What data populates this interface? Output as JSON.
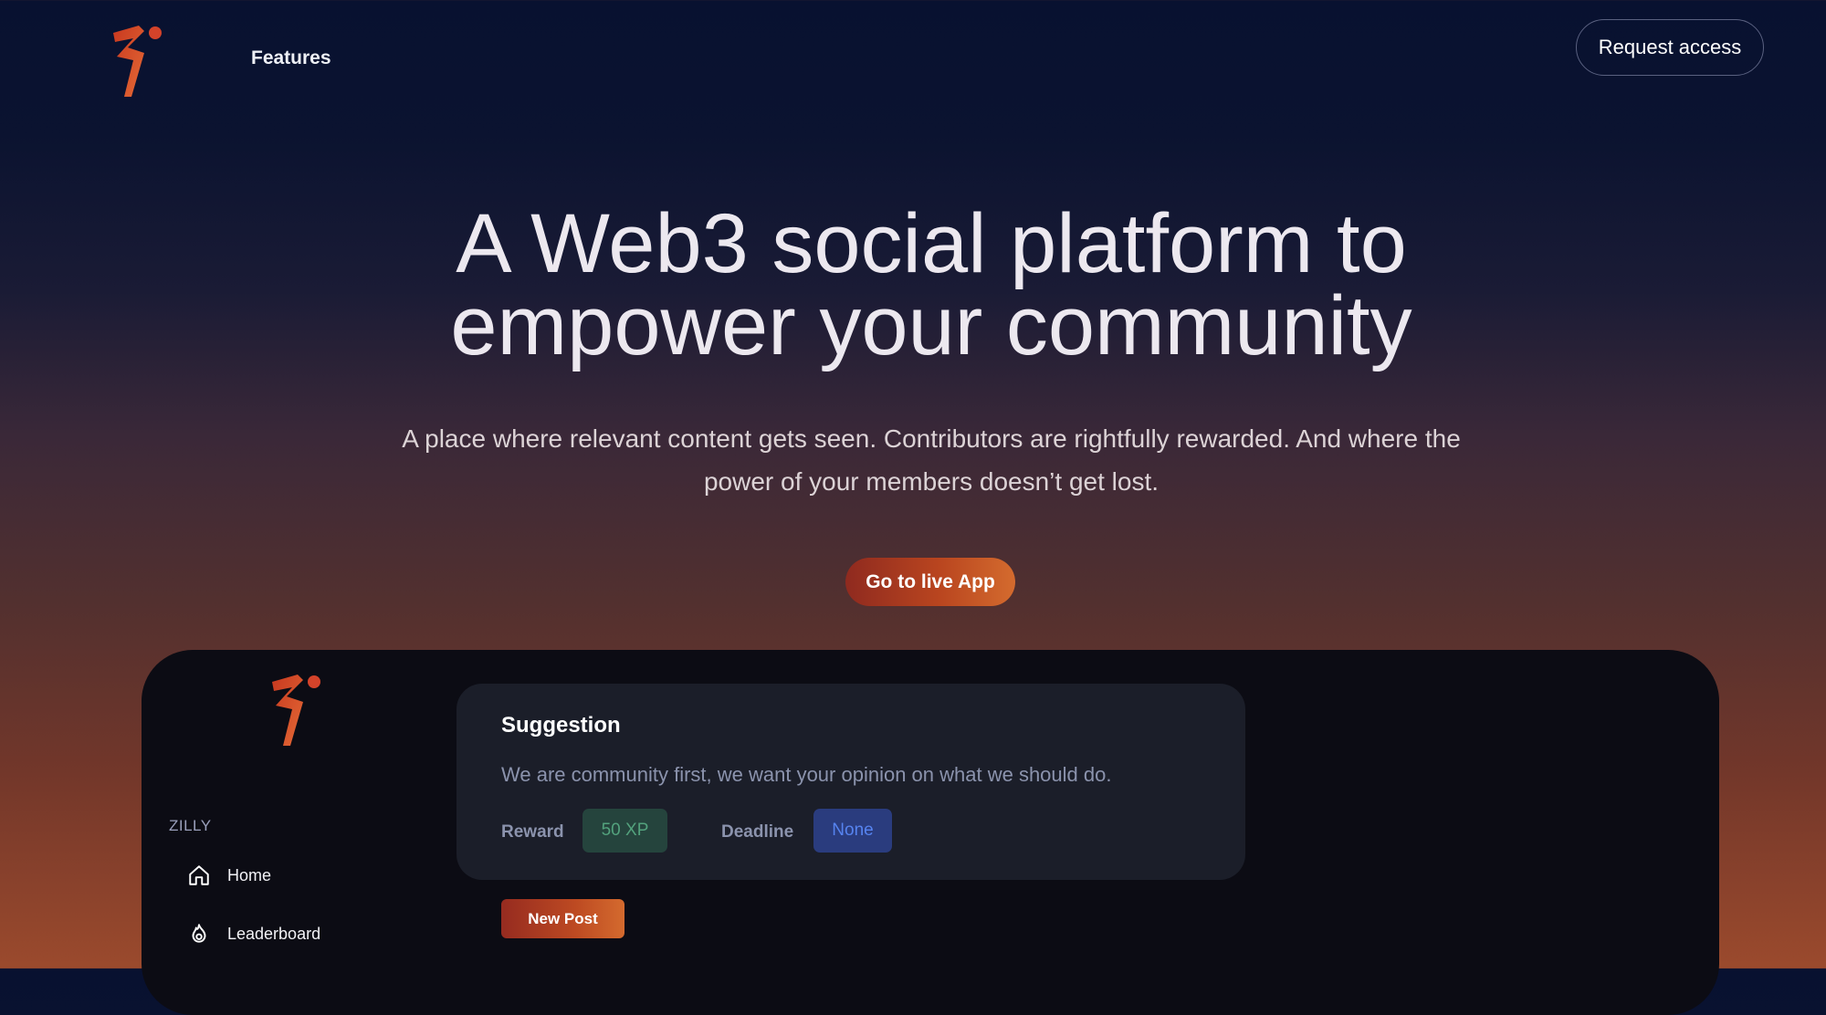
{
  "brand": {
    "logo_icon": "zilly-logo-icon",
    "accent_gradient": [
      "#8f2a1f",
      "#d46b2e"
    ]
  },
  "nav": {
    "features_label": "Features",
    "request_access_label": "Request access"
  },
  "hero": {
    "title_line1": "A Web3 social platform to",
    "title_line2": "empower your community",
    "subtitle": "A place where relevant content gets seen. Contributors are rightfully rewarded. And where the power of your members doesn’t get lost.",
    "cta_label": "Go to live App"
  },
  "app_preview": {
    "app_name": "ZILLY",
    "sidebar": {
      "items": [
        {
          "label": "Home",
          "icon": "home-icon"
        },
        {
          "label": "Leaderboard",
          "icon": "flame-icon"
        }
      ]
    },
    "suggestion_card": {
      "title": "Suggestion",
      "description": "We are community first, we want your opinion on what we should do.",
      "reward_label": "Reward",
      "reward_value": "50 XP",
      "deadline_label": "Deadline",
      "deadline_value": "None",
      "reward_color": "#53a27d",
      "deadline_color": "#5683ef"
    },
    "new_post_label": "New Post"
  }
}
